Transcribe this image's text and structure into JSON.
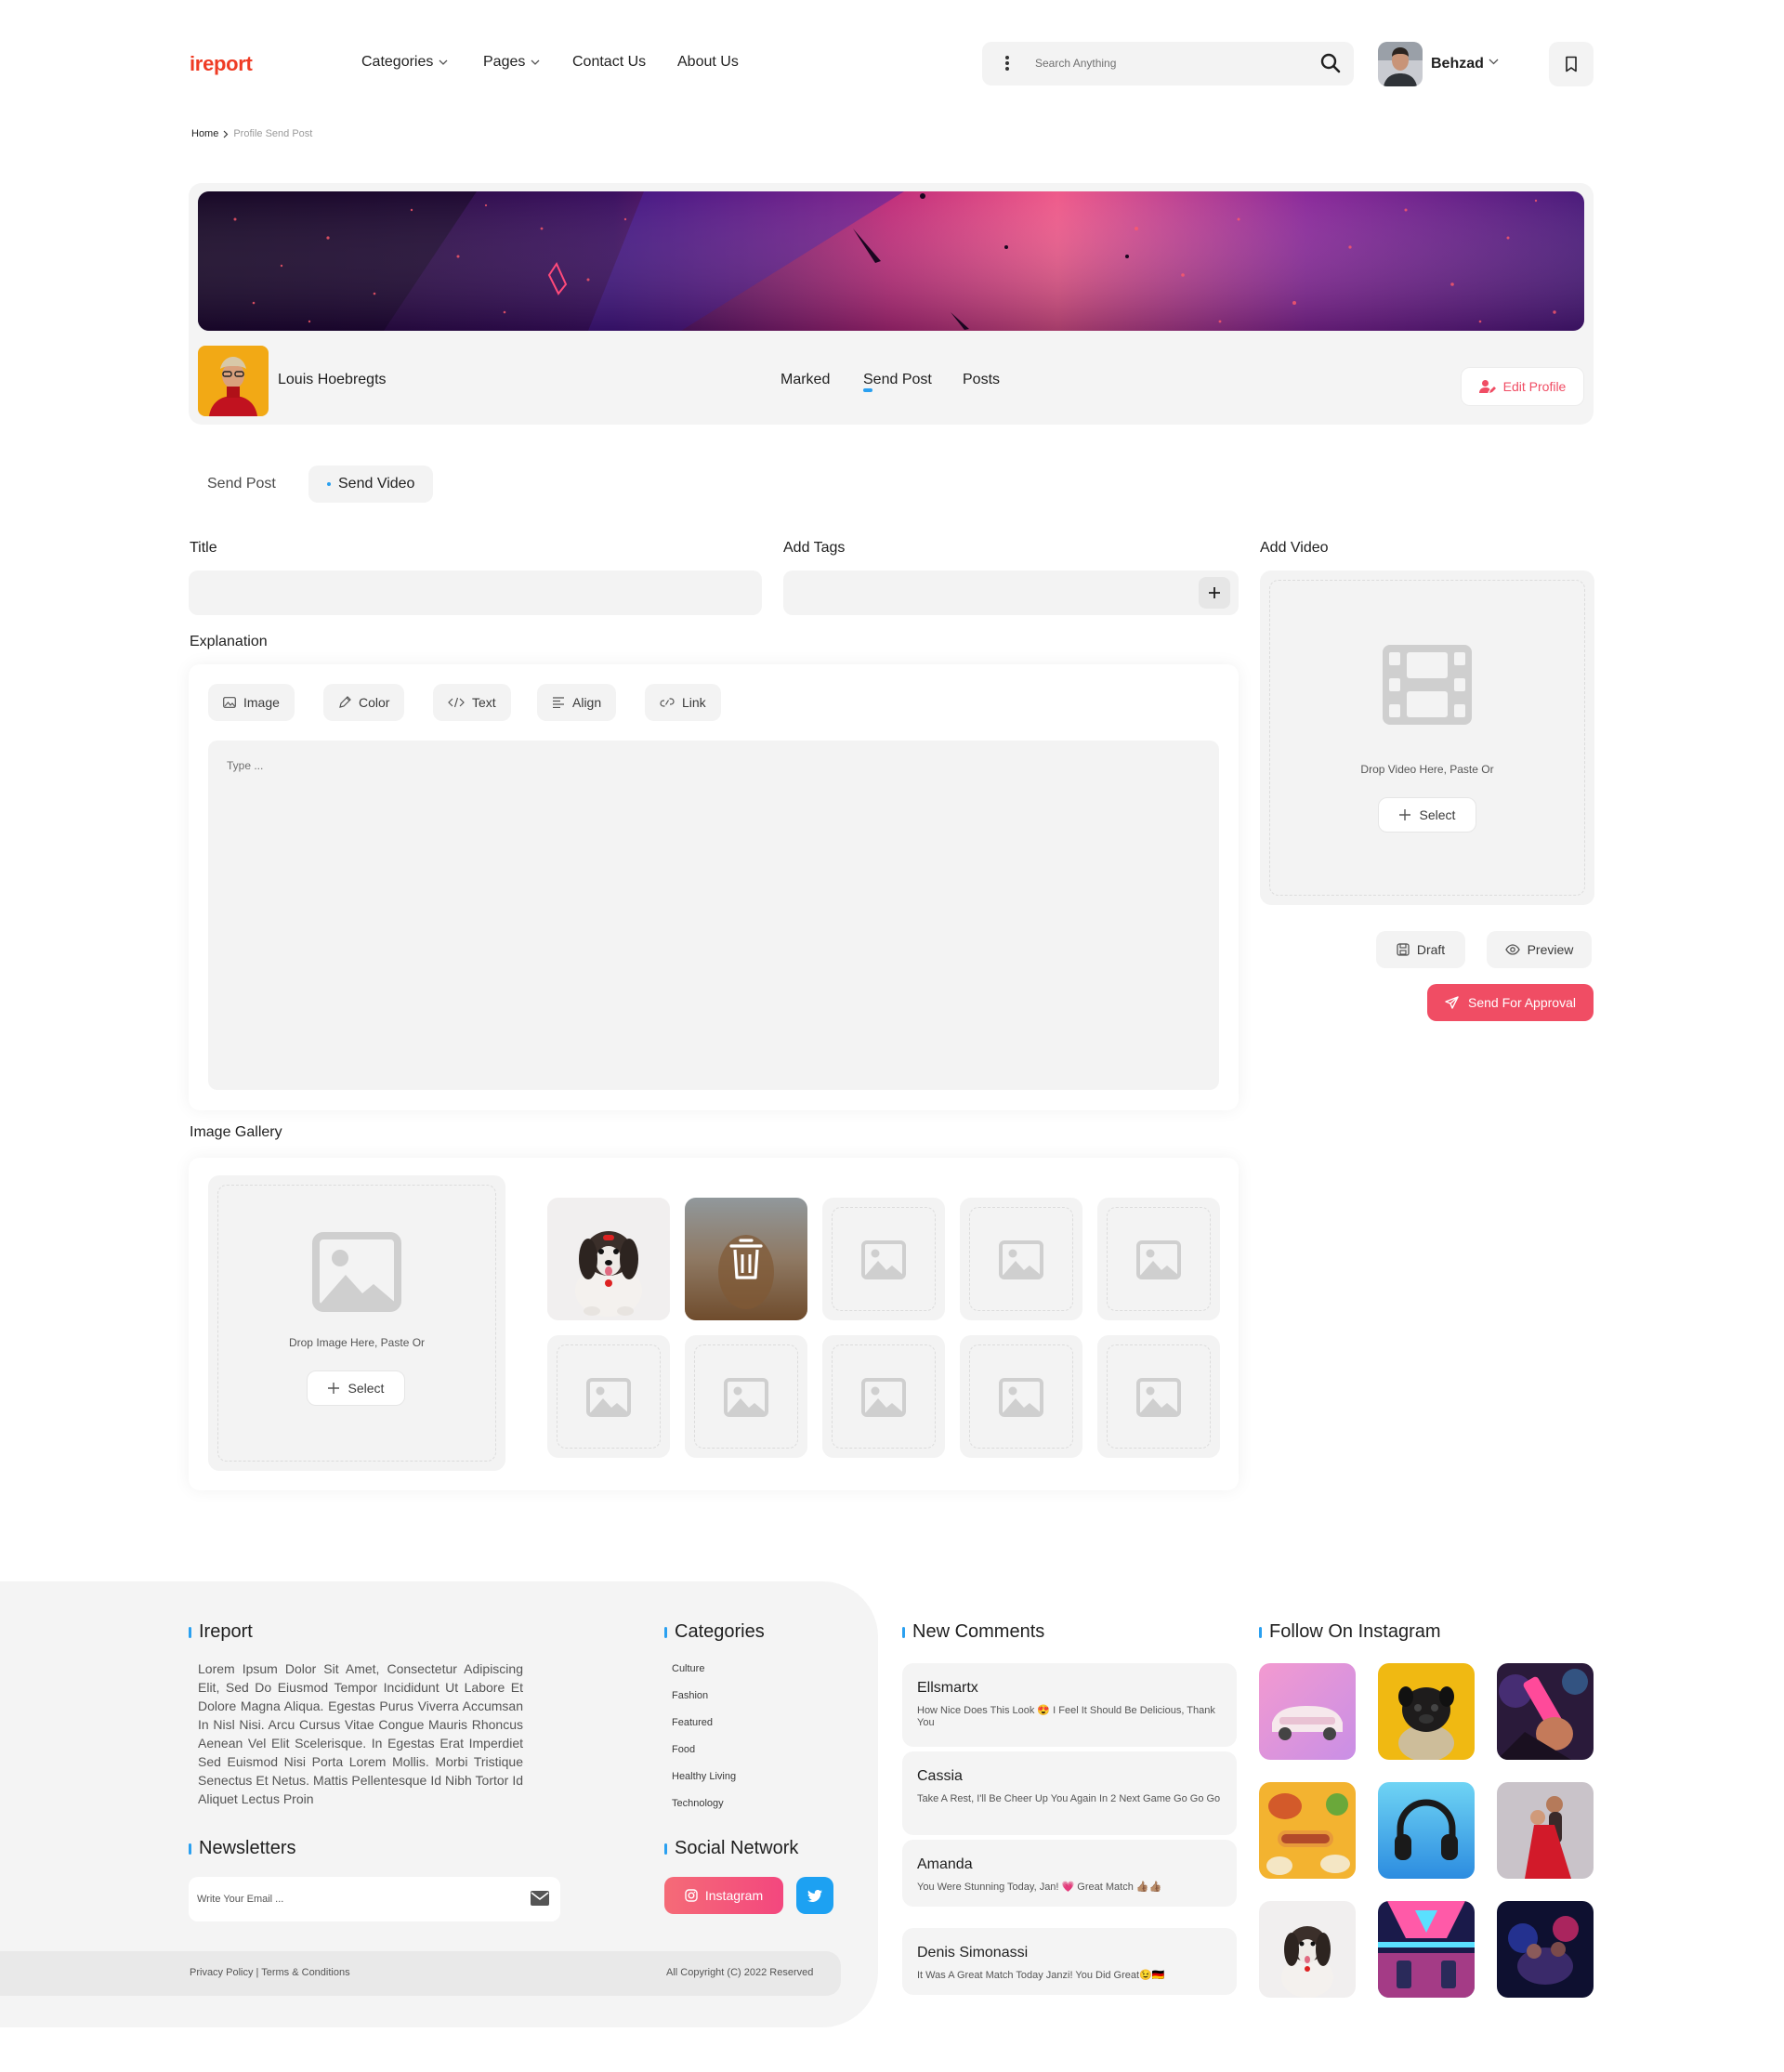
{
  "header": {
    "logo": "ireport",
    "nav": [
      "Categories",
      "Pages",
      "Contact Us",
      "About Us"
    ],
    "search_placeholder": "Search Anything",
    "user_name": "Behzad"
  },
  "breadcrumb": {
    "home": "Home",
    "current": "Profile Send Post"
  },
  "profile": {
    "name": "Louis Hoebregts",
    "tabs": [
      "Marked",
      "Send Post",
      "Posts"
    ],
    "active_tab": "Send Post",
    "edit_label": "Edit Profile"
  },
  "subtabs": {
    "send_post": "Send Post",
    "send_video": "Send Video",
    "active": "Send Video"
  },
  "form": {
    "title_label": "Title",
    "tags_label": "Add Tags",
    "video_label": "Add Video",
    "explanation_label": "Explanation",
    "tools": [
      "Image",
      "Color",
      "Text",
      "Align",
      "Link"
    ],
    "editor_placeholder": "Type ...",
    "video_drop_text": "Drop Video Here, Paste Or",
    "select_label": "Select",
    "draft_label": "Draft",
    "preview_label": "Preview",
    "approve_label": "Send For Approval",
    "gallery_label": "Image Gallery",
    "image_drop_text": "Drop Image Here, Paste Or"
  },
  "footer": {
    "brand_title": "Ireport",
    "brand_text": "Lorem Ipsum Dolor Sit Amet, Consectetur Adipiscing Elit, Sed Do Eiusmod Tempor Incididunt Ut Labore Et Dolore Magna Aliqua. Egestas Purus Viverra Accumsan In Nisl Nisi. Arcu Cursus Vitae Congue Mauris Rhoncus Aenean Vel Elit Scelerisque. In Egestas Erat Imperdiet Sed Euismod Nisi Porta Lorem Mollis. Morbi Tristique Senectus Et Netus. Mattis Pellentesque Id Nibh Tortor Id Aliquet Lectus Proin",
    "categories_title": "Categories",
    "categories": [
      "Culture",
      "Fashion",
      "Featured",
      "Food",
      "Healthy Living",
      "Technology"
    ],
    "newsletters_title": "Newsletters",
    "email_placeholder": "Write Your Email ...",
    "social_title": "Social Network",
    "instagram_label": "Instagram",
    "legal": "Privacy Policy | Terms & Conditions",
    "copyright": "All Copyright (C) 2022 Reserved",
    "comments_title": "New Comments",
    "comments": [
      {
        "name": "Ellsmartx",
        "text": "How Nice Does This Look 😍 I Feel It Should Be Delicious, Thank You"
      },
      {
        "name": "Cassia",
        "text": "Take A Rest, I'll Be Cheer Up You Again In 2 Next Game Go Go Go"
      },
      {
        "name": "Amanda",
        "text": "You Were Stunning Today, Jan! 💗 Great Match 👍🏽👍🏽"
      },
      {
        "name": "Denis Simonassi",
        "text": "It Was A Great Match Today Janzi! You Did Great😉🇩🇪"
      }
    ],
    "instagram_title": "Follow On Instagram"
  },
  "colors": {
    "brand": "#ef3b24",
    "accent": "#2aa0f0",
    "primary_button": "#f04d64",
    "twitter": "#1da1f2"
  },
  "icons": [
    "more-vertical-icon",
    "search-icon",
    "chevron-down-icon",
    "bookmark-icon",
    "user-edit-icon",
    "image-icon",
    "pen-icon",
    "code-icon",
    "align-icon",
    "link-icon",
    "film-icon",
    "plus-icon",
    "save-icon",
    "eye-icon",
    "send-icon",
    "trash-icon",
    "mail-icon",
    "instagram-icon",
    "twitter-icon"
  ]
}
